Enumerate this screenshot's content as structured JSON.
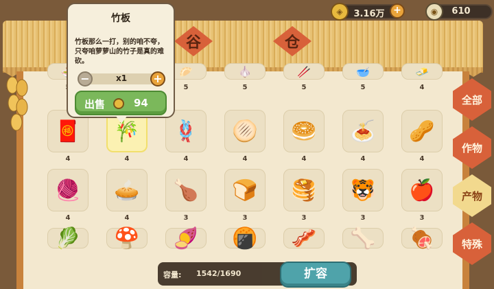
{
  "currencies": {
    "gold": {
      "icon": "copper-coin-icon",
      "value": "3.16万"
    },
    "jade": {
      "icon": "jade-coin-icon",
      "value": "610"
    }
  },
  "sign": {
    "left_char": "谷",
    "right_char": "仓"
  },
  "tabs": [
    {
      "label": "全部",
      "active": false
    },
    {
      "label": "作物",
      "active": false
    },
    {
      "label": "产物",
      "active": true
    },
    {
      "label": "特殊",
      "active": false
    }
  ],
  "grid_rows": [
    {
      "items": [
        {
          "icon": "noodle-bowl-icon",
          "emoji": "🍜",
          "count": "5"
        },
        {
          "icon": "bamboo-board-icon",
          "emoji": "🎋",
          "count": "5"
        },
        {
          "icon": "dumpling-icon",
          "emoji": "🥟",
          "count": "5"
        },
        {
          "icon": "garlic-bulb-icon",
          "emoji": "🧄",
          "count": "5"
        },
        {
          "icon": "chopsticks-icon",
          "emoji": "🥢",
          "count": "5"
        },
        {
          "icon": "brown-bowl-icon",
          "emoji": "🥣",
          "count": "5"
        },
        {
          "icon": "tofu-block-icon",
          "emoji": "🧈",
          "count": "4"
        }
      ]
    },
    {
      "items": [
        {
          "icon": "red-knot-icon",
          "emoji": "🧧",
          "count": "4"
        },
        {
          "icon": "bamboo-board-icon",
          "emoji": "🎋",
          "count": "4",
          "selected": true
        },
        {
          "icon": "rope-bundle-icon",
          "emoji": "🪢",
          "count": "4"
        },
        {
          "icon": "flatbread-icon",
          "emoji": "🫓",
          "count": "4"
        },
        {
          "icon": "steamed-bun-icon",
          "emoji": "🥯",
          "count": "4"
        },
        {
          "icon": "noodles-plate-icon",
          "emoji": "🍝",
          "count": "4"
        },
        {
          "icon": "nut-bowl-icon",
          "emoji": "🥜",
          "count": "4"
        }
      ]
    },
    {
      "items": [
        {
          "icon": "yarn-ball-icon",
          "emoji": "🧶",
          "count": "4"
        },
        {
          "icon": "meat-pie-icon",
          "emoji": "🥧",
          "count": "4"
        },
        {
          "icon": "chicken-wing-icon",
          "emoji": "🍗",
          "count": "3"
        },
        {
          "icon": "round-bread-icon",
          "emoji": "🍞",
          "count": "3"
        },
        {
          "icon": "pancakes-icon",
          "emoji": "🥞",
          "count": "3"
        },
        {
          "icon": "tiger-hat-icon",
          "emoji": "🐯",
          "count": "3"
        },
        {
          "icon": "fruit-cloth-icon",
          "emoji": "🍎",
          "count": "3"
        }
      ]
    },
    {
      "items": [
        {
          "icon": "scallion-icon",
          "emoji": "🥬",
          "count": ""
        },
        {
          "icon": "mushroom-icon",
          "emoji": "🍄",
          "count": ""
        },
        {
          "icon": "sweet-potato-icon",
          "emoji": "🍠",
          "count": ""
        },
        {
          "icon": "dough-icon",
          "emoji": "🍘",
          "count": ""
        },
        {
          "icon": "pork-icon",
          "emoji": "🥓",
          "count": ""
        },
        {
          "icon": "bone-icon",
          "emoji": "🦴",
          "count": ""
        },
        {
          "icon": "sheep-meat-icon",
          "emoji": "🍖",
          "count": ""
        }
      ]
    }
  ],
  "capacity": {
    "label": "容量:",
    "value": "1542/1690"
  },
  "expand_button": "扩容",
  "popup": {
    "title": "竹板",
    "description": "竹板那么一打，别的咱不夸，只夸咱萝萝山的竹子是真的难砍。",
    "quantity": "x1",
    "sell_label": "出售",
    "sell_price": "94"
  }
}
